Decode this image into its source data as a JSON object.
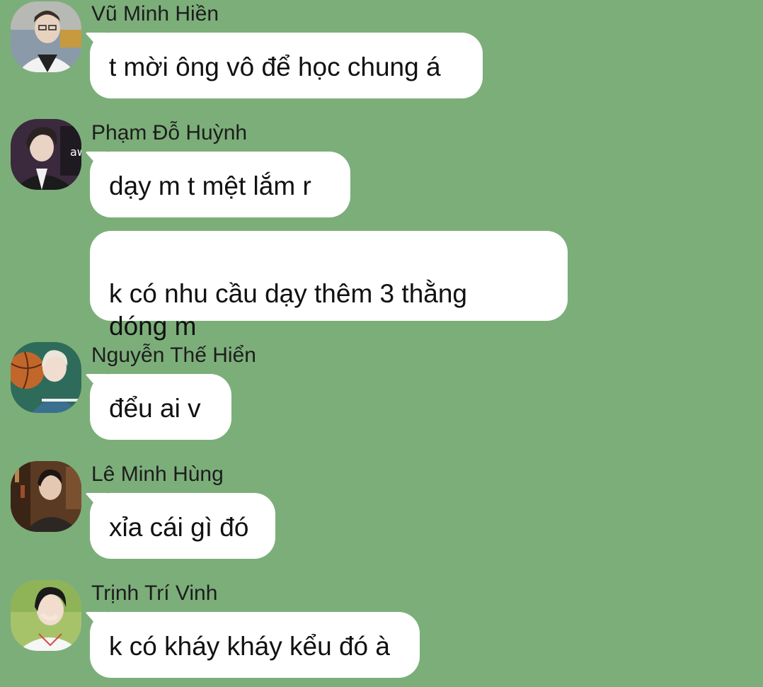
{
  "chat": {
    "messages": [
      {
        "sender": "Vũ Minh Hiền",
        "avatar": "avatar-photo-1",
        "bubbles": [
          "t mời ông vô để học chung á"
        ]
      },
      {
        "sender": "Phạm Đỗ Huỳnh",
        "avatar": "avatar-photo-2",
        "bubbles": [
          "dạy m t mệt lắm r",
          "k có nhu cầu dạy thêm 3 thằng\ndóng m"
        ]
      },
      {
        "sender": "Nguyễn Thế Hiển",
        "avatar": "avatar-photo-3",
        "bubbles": [
          "đểu ai v"
        ]
      },
      {
        "sender": "Lê Minh Hùng",
        "avatar": "avatar-photo-4",
        "bubbles": [
          "xỉa cái gì đó"
        ]
      },
      {
        "sender": "Trịnh Trí Vinh",
        "avatar": "avatar-photo-5",
        "bubbles": [
          "k có kháy kháy kểu đó à"
        ]
      }
    ]
  },
  "colors": {
    "background": "#7cae7a",
    "bubble": "#ffffff",
    "text": "#111111",
    "sender_text": "#1d1d1d"
  }
}
